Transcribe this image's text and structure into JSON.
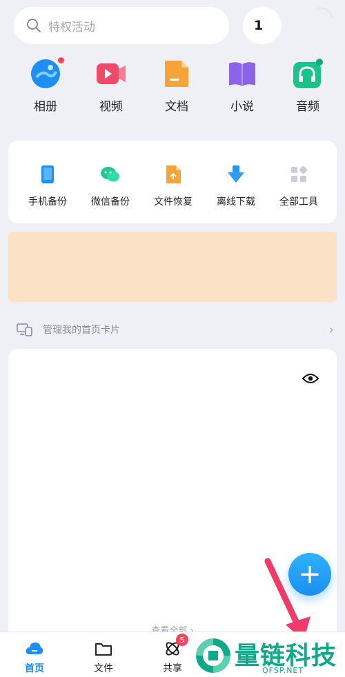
{
  "search": {
    "placeholder": "特权活动"
  },
  "avatar": {
    "text": "1"
  },
  "quick_items": [
    {
      "label": "相册",
      "icon": "photo-album-icon"
    },
    {
      "label": "视频",
      "icon": "video-icon"
    },
    {
      "label": "文档",
      "icon": "document-icon"
    },
    {
      "label": "小说",
      "icon": "novel-book-icon"
    },
    {
      "label": "音频",
      "icon": "audio-headphones-icon"
    }
  ],
  "tools": [
    {
      "label": "手机备份",
      "icon": "phone-backup-icon"
    },
    {
      "label": "微信备份",
      "icon": "wechat-backup-icon"
    },
    {
      "label": "文件恢复",
      "icon": "file-recovery-icon"
    },
    {
      "label": "离线下载",
      "icon": "offline-download-icon"
    },
    {
      "label": "全部工具",
      "icon": "all-tools-icon"
    }
  ],
  "manage": {
    "label": "管理我的首页卡片"
  },
  "card": {
    "view_all": "查看全部 ›"
  },
  "tabbar": {
    "tabs": [
      {
        "label": "首页",
        "icon": "home-cloud-icon",
        "active": true
      },
      {
        "label": "文件",
        "icon": "folder-icon",
        "active": false
      },
      {
        "label": "共享",
        "icon": "share-atom-icon",
        "active": false,
        "badge": "5"
      }
    ]
  },
  "watermark": {
    "text": "量链科技",
    "sub": "QFSP.NET"
  },
  "colors": {
    "accent": "#1d8ef2",
    "badge": "#f2475f",
    "banner": "#fbe1c5",
    "watermark": "#0fa98a",
    "arrow": "#ef3a6a"
  }
}
